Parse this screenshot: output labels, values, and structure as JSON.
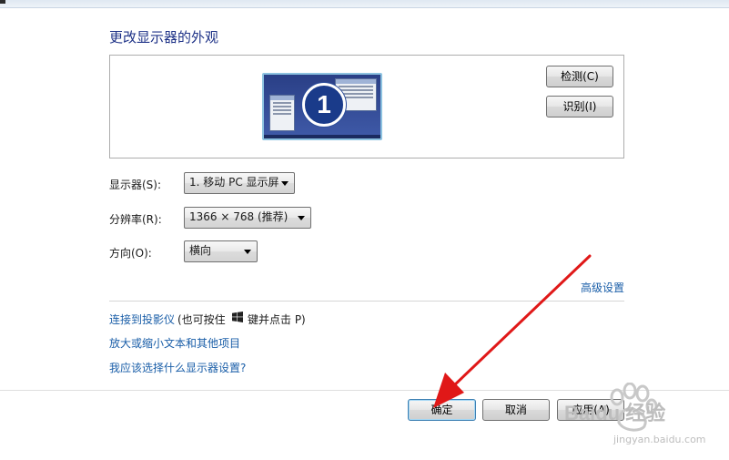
{
  "page": {
    "title": "更改显示器的外观"
  },
  "preview": {
    "monitor_number": "1"
  },
  "buttons": {
    "detect": "检测(C)",
    "identify": "识别(I)",
    "ok": "确定",
    "cancel": "取消",
    "apply": "应用(A)"
  },
  "settings": {
    "display": {
      "label": "显示器(S):",
      "value": "1. 移动 PC 显示屏"
    },
    "resolution": {
      "label": "分辨率(R):",
      "value": "1366 × 768 (推荐)"
    },
    "orientation": {
      "label": "方向(O):",
      "value": "横向"
    }
  },
  "links": {
    "advanced": "高级设置",
    "projector": "连接到投影仪",
    "projector_hint_a": "(也可按住",
    "projector_hint_b": "键并点击 P)",
    "text_size": "放大或缩小文本和其他项目",
    "which_settings": "我应该选择什么显示器设置?"
  },
  "watermark": {
    "brand": "Baidu 经验",
    "url": "jingyan.baidu.com"
  },
  "colors": {
    "accent_link": "#1a5ea8",
    "title": "#1e3287",
    "arrow": "#e01818",
    "monitor_bg": "#2a3f86"
  }
}
